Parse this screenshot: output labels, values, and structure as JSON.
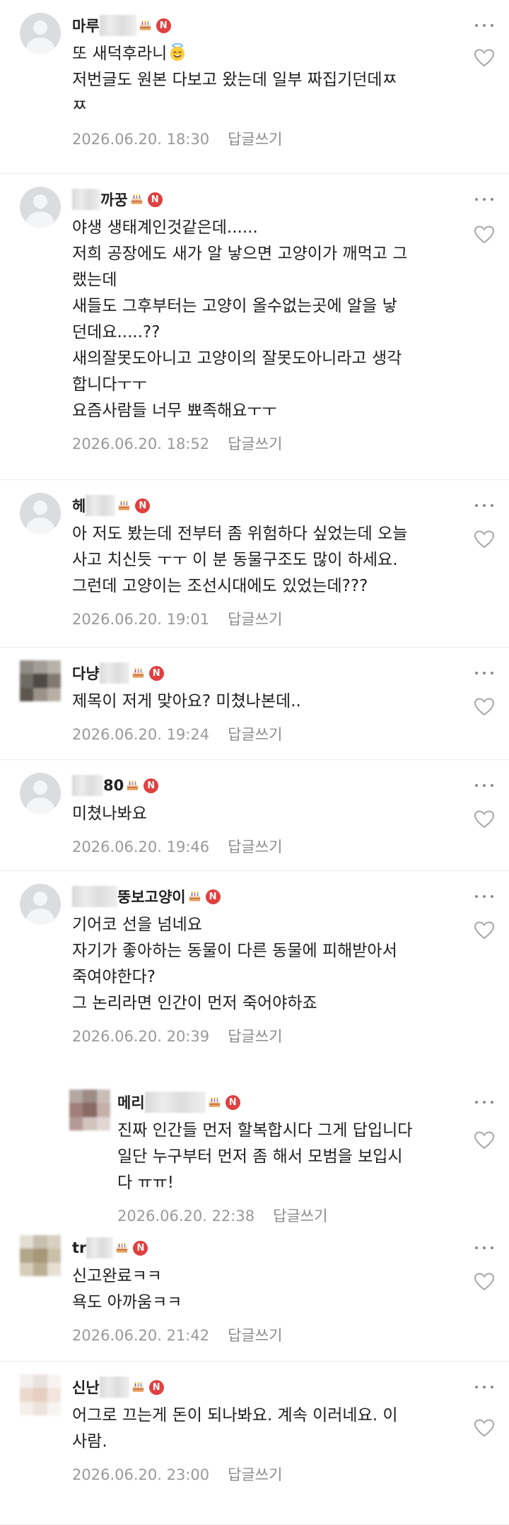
{
  "reply_link_label": "답글쓰기",
  "colors": {
    "badge": "#e0403f",
    "text": "#1f1f1f",
    "meta": "#999999",
    "divider": "#eeeeee"
  },
  "comments": [
    {
      "nick_prefix": "마루",
      "nick_suffix": "",
      "lines": [
        "또 새덕후라니",
        "저번글도 원본 다보고 왔는데 일부 짜집기던데ㅉ",
        "ㅉ"
      ],
      "trailing_emoji": "smiling-halo-emoji-icon",
      "date": "2026.06.20. 18:30",
      "reply": false
    },
    {
      "nick_prefix": "",
      "nick_suffix": "까꿍",
      "lines": [
        "야생 생태계인것같은데......",
        "저희 공장에도 새가 알 낳으면 고양이가 깨먹고 그",
        "랬는데",
        "새들도 그후부터는 고양이 올수없는곳에 알을 낳",
        "던데요.....??",
        "새의잘못도아니고 고양이의 잘못도아니라고 생각",
        "합니다ㅜㅜ",
        "요즘사람들 너무 뾰족해요ㅜㅜ"
      ],
      "date": "2026.06.20. 18:52",
      "reply": false
    },
    {
      "nick_prefix": "헤",
      "nick_suffix": "",
      "lines": [
        "아 저도 봤는데 전부터 좀 위험하다 싶었는데 오늘",
        "사고 치신듯 ㅜㅜ 이 분 동물구조도 많이 하세요.",
        "그런데 고양이는 조선시대에도 있었는데???"
      ],
      "date": "2026.06.20. 19:01",
      "reply": false
    },
    {
      "nick_prefix": "다냥",
      "nick_suffix": "",
      "lines": [
        "제목이 저게 맞아요? 미쳤나본데.."
      ],
      "date": "2026.06.20. 19:24",
      "reply": false
    },
    {
      "nick_prefix": "",
      "nick_suffix": "80",
      "lines": [
        "미쳤나봐요"
      ],
      "date": "2026.06.20. 19:46",
      "reply": false
    },
    {
      "nick_prefix": "",
      "nick_suffix": "뚱보고양이",
      "lines": [
        "기어코 선을 넘네요",
        "자기가 좋아하는 동물이 다른 동물에 피해받아서",
        "죽여야한다?",
        "그 논리라면 인간이 먼저 죽어야하죠"
      ],
      "date": "2026.06.20. 20:39",
      "reply": false
    },
    {
      "nick_prefix": "메리",
      "nick_suffix": "",
      "lines": [
        "진짜 인간들 먼저 할복합시다 그게 답입니다",
        "일단 누구부터 먼저 좀 해서 모범을 보입시",
        "다 ㅠㅠ!"
      ],
      "date": "2026.06.20. 22:38",
      "reply": true
    },
    {
      "nick_prefix": "tr",
      "nick_suffix": "",
      "lines": [
        "신고완료ㅋㅋ",
        "욕도 아까움ㅋㅋ"
      ],
      "date": "2026.06.20. 21:42",
      "reply": false
    },
    {
      "nick_prefix": "신난",
      "nick_suffix": "",
      "lines": [
        "어그로 끄는게 돈이 되나봐요. 계속 이러네요. 이",
        "사람."
      ],
      "date": "2026.06.20. 23:00",
      "reply": false
    }
  ]
}
